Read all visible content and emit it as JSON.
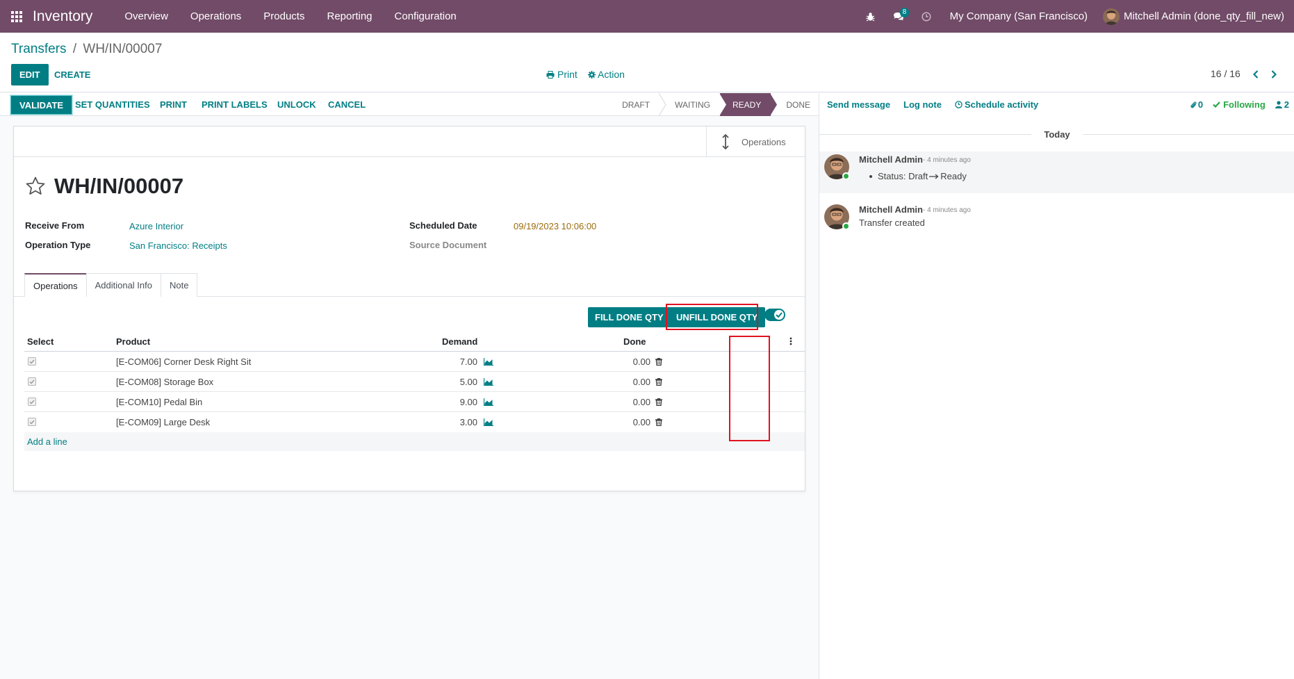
{
  "navbar": {
    "app_name": "Inventory",
    "menu": [
      "Overview",
      "Operations",
      "Products",
      "Reporting",
      "Configuration"
    ],
    "messages_count": "8",
    "company": "My Company (San Francisco)",
    "user": "Mitchell Admin (done_qty_fill_new)"
  },
  "breadcrumb": {
    "parent": "Transfers",
    "separator": "/",
    "current": "WH/IN/00007"
  },
  "control": {
    "edit": "EDIT",
    "create": "CREATE",
    "print": "Print",
    "action": "Action",
    "pager": "16 / 16"
  },
  "statusbar": {
    "buttons": [
      "VALIDATE",
      "SET QUANTITIES",
      "PRINT",
      "PRINT LABELS",
      "UNLOCK",
      "CANCEL"
    ],
    "states": [
      "DRAFT",
      "WAITING",
      "READY",
      "DONE"
    ],
    "current_state": "READY"
  },
  "form": {
    "smart_button": "Operations",
    "title": "WH/IN/00007",
    "receive_from_label": "Receive From",
    "receive_from": "Azure Interior",
    "operation_type_label": "Operation Type",
    "operation_type": "San Francisco: Receipts",
    "scheduled_date_label": "Scheduled Date",
    "scheduled_date": "09/19/2023 10:06:00",
    "source_document_label": "Source Document",
    "tabs": [
      "Operations",
      "Additional Info",
      "Note"
    ],
    "fill_done_qty": "FILL DONE QTY",
    "unfill_done_qty": "UNFILL DONE QTY",
    "columns": {
      "select": "Select",
      "product": "Product",
      "demand": "Demand",
      "done": "Done"
    },
    "lines": [
      {
        "product": "[E-COM06] Corner Desk Right Sit",
        "demand": "7.00",
        "done": "0.00"
      },
      {
        "product": "[E-COM08] Storage Box",
        "demand": "5.00",
        "done": "0.00"
      },
      {
        "product": "[E-COM10] Pedal Bin",
        "demand": "9.00",
        "done": "0.00"
      },
      {
        "product": "[E-COM09] Large Desk",
        "demand": "3.00",
        "done": "0.00"
      }
    ],
    "add_line": "Add a line"
  },
  "chatter": {
    "send_message": "Send message",
    "log_note": "Log note",
    "schedule_activity": "Schedule activity",
    "attachments": "0",
    "following": "Following",
    "followers": "2",
    "today": "Today",
    "messages": [
      {
        "author": "Mitchell Admin",
        "time": "- 4 minutes ago",
        "status_label": "Status:",
        "from": "Draft",
        "to": "Ready"
      },
      {
        "author": "Mitchell Admin",
        "time": "- 4 minutes ago",
        "body": "Transfer created"
      }
    ]
  },
  "colors": {
    "brand": "#714b67",
    "accent": "#017e84",
    "highlight": "#e0121f"
  }
}
